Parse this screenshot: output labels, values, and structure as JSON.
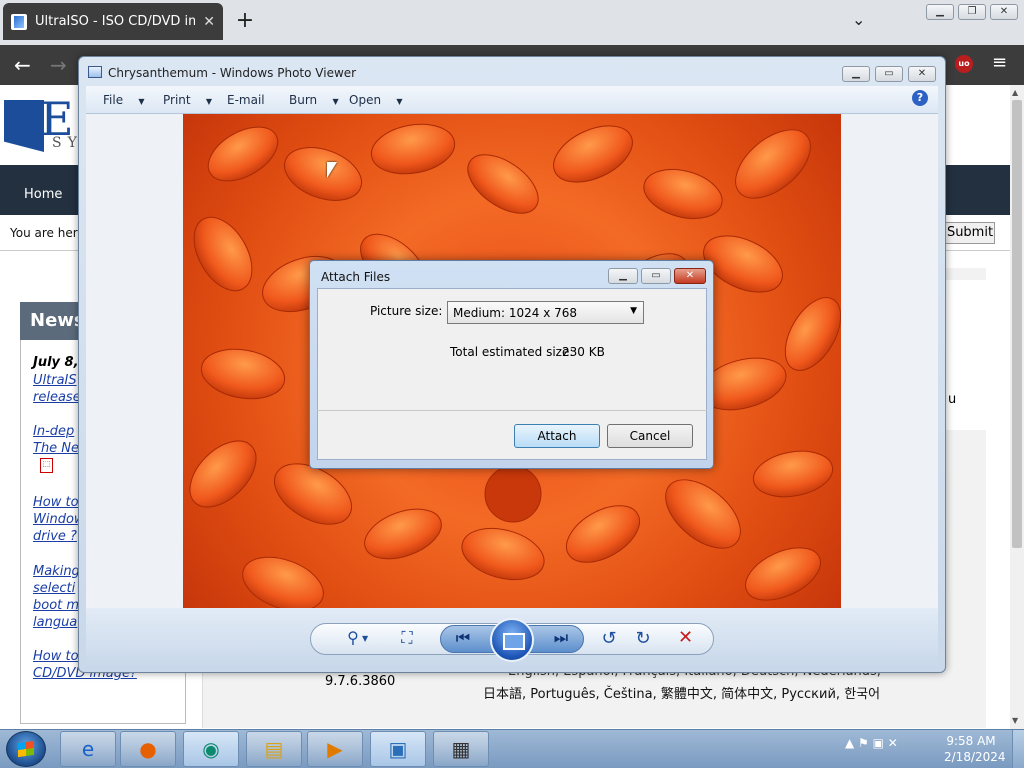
{
  "browser": {
    "tab_title": "UltraISO - ISO CD/DVD image c",
    "tab_close": "✕",
    "new_tab": "+",
    "tab_menu": "⌄",
    "back": "←",
    "forward": "→",
    "extension_badge": "uo",
    "menu": "≡"
  },
  "website": {
    "logo_text": "E",
    "logo_sub": "SY",
    "nav_home": "Home",
    "breadcrumb_prefix": "You are her",
    "submit_label": "Submit",
    "news_heading": "News",
    "news_items": [
      {
        "bold": "July 8,",
        "lines": [
          "UltraIS",
          "release"
        ]
      },
      {
        "lines": [
          "In-dep",
          "The Ne"
        ]
      },
      {
        "lines": [
          "How to",
          "Window",
          "drive ?"
        ]
      },
      {
        "lines": [
          "Making",
          "selecti",
          "boot m",
          "langua"
        ]
      },
      {
        "lines": [
          "How to",
          "CD/DVD image?"
        ]
      }
    ],
    "right_fragment": "u",
    "version": "9.7.6.3860",
    "languages_line1": "English, Español, Français, Italiano, Deutsch, Nederlands,",
    "languages_line2": "日本語, Português, Čeština, 繁體中文, 简体中文, Русский, 한국어"
  },
  "photo_viewer": {
    "title": "Chrysanthemum - Windows Photo Viewer",
    "menu": [
      {
        "label": "File",
        "arrow": "▼"
      },
      {
        "label": "Print",
        "arrow": "▼"
      },
      {
        "label": "E-mail",
        "arrow": ""
      },
      {
        "label": "Burn",
        "arrow": "▼"
      },
      {
        "label": "Open",
        "arrow": "▼"
      }
    ],
    "help": "?",
    "controls": {
      "zoom": "⚲",
      "fit": "⛶",
      "prev": "⏮",
      "next": "⏭",
      "rotate_ccw": "↺",
      "rotate_cw": "↻",
      "delete": "✕"
    }
  },
  "dialog": {
    "title": "Attach Files",
    "picture_size_label": "Picture size:",
    "picture_size_value": "Medium: 1024 x 768",
    "total_label": "Total estimated size:",
    "total_value": "230 KB",
    "attach_label": "Attach",
    "cancel_label": "Cancel"
  },
  "taskbar": {
    "time": "9:58 AM",
    "date": "2/18/2024",
    "tray_icons": "▲ ⚑ ▣ ✕"
  }
}
